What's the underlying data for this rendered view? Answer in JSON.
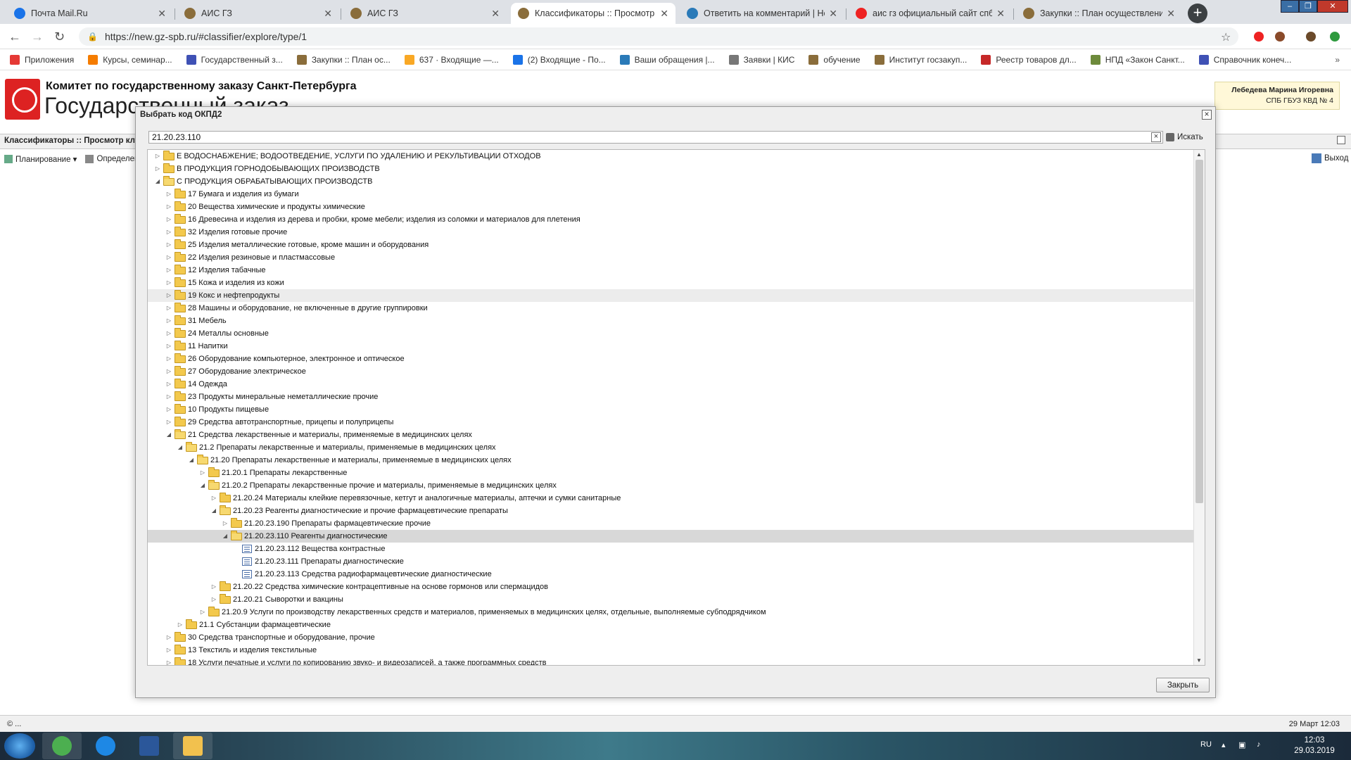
{
  "browser": {
    "tabs": [
      {
        "title": "Почта Mail.Ru",
        "favicon": "mail-icon",
        "color": "#1a73e8",
        "active": false
      },
      {
        "title": "АИС ГЗ",
        "favicon": "hammer-icon",
        "color": "#8a6d3b",
        "active": false
      },
      {
        "title": "АИС ГЗ",
        "favicon": "hammer-icon",
        "color": "#8a6d3b",
        "active": false
      },
      {
        "title": "Классификаторы :: Просмотр кл",
        "favicon": "hammer-icon",
        "color": "#8a6d3b",
        "active": true
      },
      {
        "title": "Ответить на комментарий | Hel",
        "favicon": "globe-icon",
        "color": "#2a7ab8",
        "active": false
      },
      {
        "title": "аис гз официальный сайт спб н",
        "favicon": "yandex-icon",
        "color": "#e22",
        "active": false
      },
      {
        "title": "Закупки :: План осуществления",
        "favicon": "hammer-icon",
        "color": "#8a6d3b",
        "active": false
      }
    ],
    "url": "https://new.gz-spb.ru/#classifier/explore/type/1",
    "bookmarks": [
      {
        "label": "Приложения",
        "color": "#e53935"
      },
      {
        "label": "Курсы, семинар...",
        "color": "#f57c00"
      },
      {
        "label": "Государственный з...",
        "color": "#3f51b5"
      },
      {
        "label": "Закупки :: План ос...",
        "color": "#8a6d3b"
      },
      {
        "label": "637 · Входящие —...",
        "color": "#f9a825"
      },
      {
        "label": "(2) Входящие - По...",
        "color": "#1a73e8"
      },
      {
        "label": "Ваши обращения |...",
        "color": "#2a7ab8"
      },
      {
        "label": "Заявки | КИС",
        "color": "#777777"
      },
      {
        "label": "обучение",
        "color": "#8a6d3b"
      },
      {
        "label": "Институт госзакуп...",
        "color": "#8a6d3b"
      },
      {
        "label": "Реестр товаров дл...",
        "color": "#c62828"
      },
      {
        "label": "НПД «Закон Санкт...",
        "color": "#6d8a3b"
      },
      {
        "label": "Справочник конеч...",
        "color": "#3f51b5"
      }
    ],
    "bookmarks_more": "»"
  },
  "app": {
    "org_line1": "Комитет по государственному заказу Санкт-Петербурга",
    "org_line2": "Государственный заказ",
    "user_name": "Лебедева Марина Игоревна",
    "user_org": "СПБ ГБУЗ КВД № 4",
    "section_title": "Классификаторы :: Просмотр кл",
    "menu": [
      {
        "label": "Планирование ▾"
      },
      {
        "label": "Определен"
      }
    ],
    "exit_label": "Выход",
    "status_left": "© ...",
    "status_right": "29 Март 12:03"
  },
  "dialog": {
    "title": "Выбрать код ОКПД2",
    "search_value": "21.20.23.110",
    "search_button": "Искать",
    "close_button": "Закрыть",
    "tree": [
      {
        "level": 0,
        "label": "E ВОДОСНАБЖЕНИЕ; ВОДООТВЕДЕНИЕ, УСЛУГИ ПО УДАЛЕНИЮ И РЕКУЛЬТИВАЦИИ ОТХОДОВ",
        "type": "folder",
        "expanded": false
      },
      {
        "level": 0,
        "label": "B ПРОДУКЦИЯ ГОРНОДОБЫВАЮЩИХ ПРОИЗВОДСТВ",
        "type": "folder",
        "expanded": false
      },
      {
        "level": 0,
        "label": "C ПРОДУКЦИЯ ОБРАБАТЫВАЮЩИХ ПРОИЗВОДСТВ",
        "type": "folder",
        "expanded": true
      },
      {
        "level": 1,
        "label": "17 Бумага и изделия из бумаги",
        "type": "folder",
        "expanded": false
      },
      {
        "level": 1,
        "label": "20 Вещества химические и продукты химические",
        "type": "folder",
        "expanded": false
      },
      {
        "level": 1,
        "label": "16 Древесина и изделия из дерева и пробки, кроме мебели; изделия из соломки и материалов для плетения",
        "type": "folder",
        "expanded": false
      },
      {
        "level": 1,
        "label": "32 Изделия готовые прочие",
        "type": "folder",
        "expanded": false
      },
      {
        "level": 1,
        "label": "25 Изделия металлические готовые, кроме машин и оборудования",
        "type": "folder",
        "expanded": false
      },
      {
        "level": 1,
        "label": "22 Изделия резиновые и пластмассовые",
        "type": "folder",
        "expanded": false
      },
      {
        "level": 1,
        "label": "12 Изделия табачные",
        "type": "folder",
        "expanded": false
      },
      {
        "level": 1,
        "label": "15 Кожа и изделия из кожи",
        "type": "folder",
        "expanded": false
      },
      {
        "level": 1,
        "label": "19 Кокс и нефтепродукты",
        "type": "folder",
        "expanded": false,
        "state": "hover"
      },
      {
        "level": 1,
        "label": "28 Машины и оборудование, не включенные в другие группировки",
        "type": "folder",
        "expanded": false
      },
      {
        "level": 1,
        "label": "31 Мебель",
        "type": "folder",
        "expanded": false
      },
      {
        "level": 1,
        "label": "24 Металлы основные",
        "type": "folder",
        "expanded": false
      },
      {
        "level": 1,
        "label": "11 Напитки",
        "type": "folder",
        "expanded": false
      },
      {
        "level": 1,
        "label": "26 Оборудование компьютерное, электронное и оптическое",
        "type": "folder",
        "expanded": false
      },
      {
        "level": 1,
        "label": "27 Оборудование электрическое",
        "type": "folder",
        "expanded": false
      },
      {
        "level": 1,
        "label": "14 Одежда",
        "type": "folder",
        "expanded": false
      },
      {
        "level": 1,
        "label": "23 Продукты минеральные неметаллические прочие",
        "type": "folder",
        "expanded": false
      },
      {
        "level": 1,
        "label": "10 Продукты пищевые",
        "type": "folder",
        "expanded": false
      },
      {
        "level": 1,
        "label": "29 Средства автотранспортные, прицепы и полуприцепы",
        "type": "folder",
        "expanded": false
      },
      {
        "level": 1,
        "label": "21 Средства лекарственные и материалы, применяемые в медицинских целях",
        "type": "folder",
        "expanded": true
      },
      {
        "level": 2,
        "label": "21.2 Препараты лекарственные и материалы, применяемые в медицинских целях",
        "type": "folder",
        "expanded": true
      },
      {
        "level": 3,
        "label": "21.20 Препараты лекарственные и материалы, применяемые в медицинских целях",
        "type": "folder",
        "expanded": true
      },
      {
        "level": 4,
        "label": "21.20.1 Препараты лекарственные",
        "type": "folder",
        "expanded": false
      },
      {
        "level": 4,
        "label": "21.20.2 Препараты лекарственные прочие и материалы, применяемые в медицинских целях",
        "type": "folder",
        "expanded": true
      },
      {
        "level": 5,
        "label": "21.20.24 Материалы клейкие перевязочные, кетгут и аналогичные материалы, аптечки и сумки санитарные",
        "type": "folder",
        "expanded": false
      },
      {
        "level": 5,
        "label": "21.20.23 Реагенты диагностические и прочие фармацевтические препараты",
        "type": "folder",
        "expanded": true
      },
      {
        "level": 6,
        "label": "21.20.23.190 Препараты фармацевтические прочие",
        "type": "folder",
        "expanded": false
      },
      {
        "level": 6,
        "label": "21.20.23.110 Реагенты диагностические",
        "type": "folder",
        "expanded": true,
        "state": "selected"
      },
      {
        "level": 7,
        "label": "21.20.23.112 Вещества контрастные",
        "type": "leaf"
      },
      {
        "level": 7,
        "label": "21.20.23.111 Препараты диагностические",
        "type": "leaf"
      },
      {
        "level": 7,
        "label": "21.20.23.113 Средства радиофармацевтические диагностические",
        "type": "leaf"
      },
      {
        "level": 5,
        "label": "21.20.22 Средства химические контрацептивные на основе гормонов или спермацидов",
        "type": "folder",
        "expanded": false
      },
      {
        "level": 5,
        "label": "21.20.21 Сыворотки и вакцины",
        "type": "folder",
        "expanded": false
      },
      {
        "level": 4,
        "label": "21.20.9 Услуги по производству лекарственных средств и материалов, применяемых в медицинских целях, отдельные, выполняемые субподрядчиком",
        "type": "folder",
        "expanded": false
      },
      {
        "level": 2,
        "label": "21.1 Субстанции фармацевтические",
        "type": "folder",
        "expanded": false
      },
      {
        "level": 1,
        "label": "30 Средства транспортные и оборудование, прочие",
        "type": "folder",
        "expanded": false
      },
      {
        "level": 1,
        "label": "13 Текстиль и изделия текстильные",
        "type": "folder",
        "expanded": false
      },
      {
        "level": 1,
        "label": "18 Услуги печатные и услуги по копированию звуко- и видеозаписей, а также программных средств",
        "type": "folder",
        "expanded": false
      }
    ]
  },
  "taskbar": {
    "lang": "RU",
    "time": "12:03",
    "date": "29.03.2019",
    "apps": [
      {
        "name": "chrome-app",
        "color": "#4caf50"
      },
      {
        "name": "ie-app",
        "color": "#1e88e5"
      },
      {
        "name": "word-app",
        "color": "#2b579a"
      },
      {
        "name": "explorer-app",
        "color": "#f2c14e"
      }
    ]
  }
}
